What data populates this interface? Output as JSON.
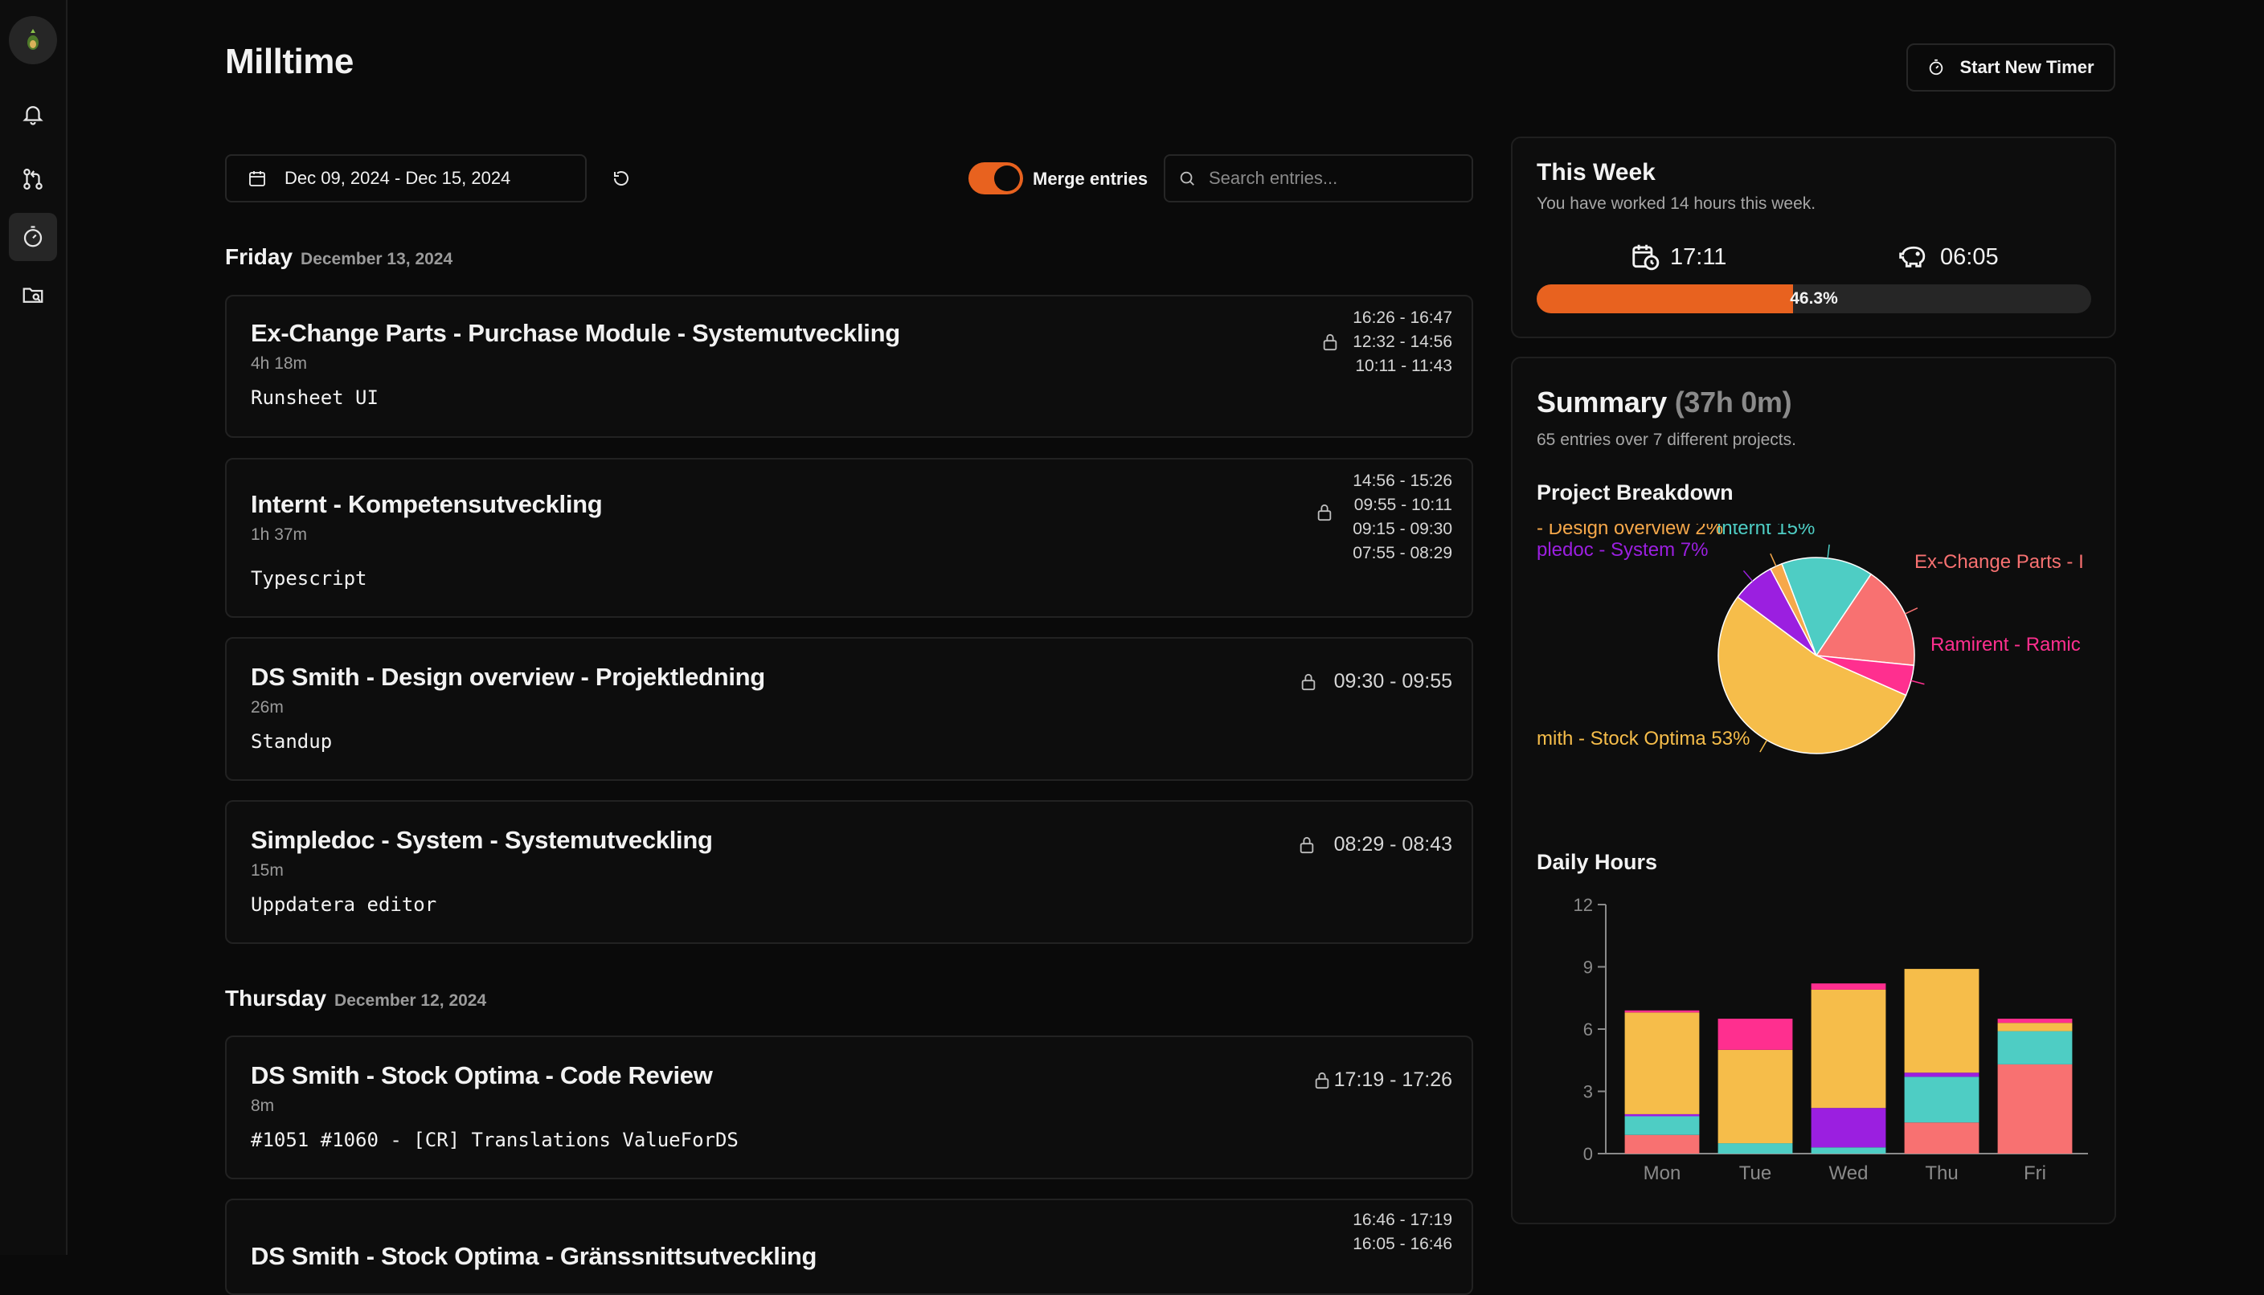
{
  "app": {
    "title": "Milltime"
  },
  "header": {
    "new_timer_label": "Start New Timer"
  },
  "filters": {
    "date_range": "Dec 09, 2024 - Dec 15, 2024",
    "merge_label": "Merge entries",
    "merge_enabled": true,
    "search_placeholder": "Search entries..."
  },
  "days": [
    {
      "name": "Friday",
      "date": "December 13, 2024",
      "entries": [
        {
          "title": "Ex-Change Parts - Purchase Module - Systemutveckling",
          "duration": "4h 18m",
          "description": "Runsheet UI",
          "times": [
            "16:26 - 16:47",
            "12:32 - 14:56",
            "10:11 - 11:43"
          ]
        },
        {
          "title": "Internt - Kompetensutveckling",
          "duration": "1h 37m",
          "description": "Typescript",
          "times": [
            "14:56 - 15:26",
            "09:55 - 10:11",
            "09:15 - 09:30",
            "07:55 - 08:29"
          ]
        },
        {
          "title": "DS Smith - Design overview - Projektledning",
          "duration": "26m",
          "description": "Standup",
          "times": [
            "09:30 - 09:55"
          ]
        },
        {
          "title": "Simpledoc - System - Systemutveckling",
          "duration": "15m",
          "description": "Uppdatera editor",
          "times": [
            "08:29 - 08:43"
          ]
        }
      ]
    },
    {
      "name": "Thursday",
      "date": "December 12, 2024",
      "entries": [
        {
          "title": "DS Smith - Stock Optima - Code Review",
          "duration": "8m",
          "description": "#1051 #1060 - [CR] Translations ValueForDS",
          "times": [
            "17:19 - 17:26"
          ]
        },
        {
          "title": "DS Smith - Stock Optima - Gränssnittsutveckling",
          "duration": "",
          "description": "",
          "times": [
            "16:46 - 17:19",
            "16:05 - 16:46"
          ]
        }
      ]
    }
  ],
  "this_week": {
    "title": "This Week",
    "subtitle": "You have worked 14 hours this week.",
    "clock_time": "17:11",
    "piggy_time": "06:05",
    "progress": 46.3,
    "progress_label": "46.3%",
    "accent": "#e8621f"
  },
  "summary": {
    "title": "Summary",
    "total": "(37h 0m)",
    "subtitle": "65 entries over 7 different projects.",
    "breakdown_title": "Project Breakdown",
    "daily_title": "Daily Hours"
  },
  "chart_data": [
    {
      "type": "pie",
      "title": "Project Breakdown",
      "slices": [
        {
          "label": "Internt 15%",
          "value": 15,
          "color": "#4ecdc4"
        },
        {
          "label": "Ex-Change Parts - I",
          "value": 17,
          "color": "#f87171"
        },
        {
          "label": "Ramirent - Ramic",
          "value": 5,
          "color": "#ff2f8f"
        },
        {
          "label": "mith - Stock Optima 53%",
          "value": 53,
          "color": "#f6bd4a"
        },
        {
          "label": "pledoc - System 7%",
          "value": 7,
          "color": "#9b1fe0"
        },
        {
          "label": "- Design overview 2%",
          "value": 2,
          "color": "#f6a84a"
        }
      ]
    },
    {
      "type": "bar",
      "stacked": true,
      "title": "Daily Hours",
      "categories": [
        "Mon",
        "Tue",
        "Wed",
        "Thu",
        "Fri"
      ],
      "ylim": [
        0,
        12
      ],
      "yticks": [
        0,
        3,
        6,
        9,
        12
      ],
      "series": [
        {
          "color": "#f87171",
          "values": [
            0.9,
            0,
            0,
            1.5,
            4.3
          ]
        },
        {
          "color": "#4ecdc4",
          "values": [
            0.9,
            0.5,
            0.3,
            2.2,
            1.6
          ]
        },
        {
          "color": "#9b1fe0",
          "values": [
            0.1,
            0,
            1.9,
            0.2,
            0
          ]
        },
        {
          "color": "#f6bd4a",
          "values": [
            4.9,
            4.5,
            5.7,
            5.0,
            0.4
          ]
        },
        {
          "color": "#ff2f8f",
          "values": [
            0.1,
            1.5,
            0.3,
            0,
            0.2
          ]
        }
      ]
    }
  ]
}
